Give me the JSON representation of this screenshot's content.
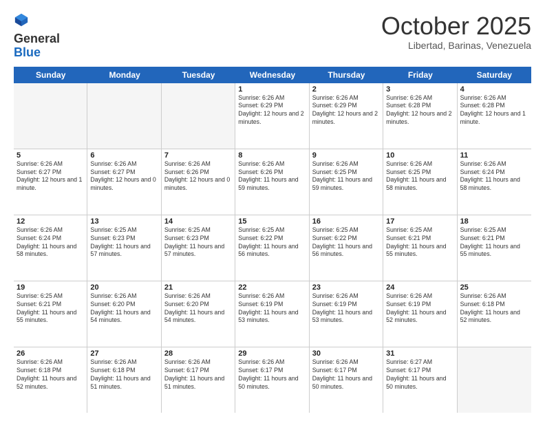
{
  "header": {
    "logo_general": "General",
    "logo_blue": "Blue",
    "month": "October 2025",
    "location": "Libertad, Barinas, Venezuela"
  },
  "days_of_week": [
    "Sunday",
    "Monday",
    "Tuesday",
    "Wednesday",
    "Thursday",
    "Friday",
    "Saturday"
  ],
  "weeks": [
    [
      {
        "day": "",
        "sunrise": "",
        "sunset": "",
        "daylight": "",
        "empty": true
      },
      {
        "day": "",
        "sunrise": "",
        "sunset": "",
        "daylight": "",
        "empty": true
      },
      {
        "day": "",
        "sunrise": "",
        "sunset": "",
        "daylight": "",
        "empty": true
      },
      {
        "day": "1",
        "sunrise": "Sunrise: 6:26 AM",
        "sunset": "Sunset: 6:29 PM",
        "daylight": "Daylight: 12 hours and 2 minutes.",
        "empty": false
      },
      {
        "day": "2",
        "sunrise": "Sunrise: 6:26 AM",
        "sunset": "Sunset: 6:29 PM",
        "daylight": "Daylight: 12 hours and 2 minutes.",
        "empty": false
      },
      {
        "day": "3",
        "sunrise": "Sunrise: 6:26 AM",
        "sunset": "Sunset: 6:28 PM",
        "daylight": "Daylight: 12 hours and 2 minutes.",
        "empty": false
      },
      {
        "day": "4",
        "sunrise": "Sunrise: 6:26 AM",
        "sunset": "Sunset: 6:28 PM",
        "daylight": "Daylight: 12 hours and 1 minute.",
        "empty": false
      }
    ],
    [
      {
        "day": "5",
        "sunrise": "Sunrise: 6:26 AM",
        "sunset": "Sunset: 6:27 PM",
        "daylight": "Daylight: 12 hours and 1 minute.",
        "empty": false
      },
      {
        "day": "6",
        "sunrise": "Sunrise: 6:26 AM",
        "sunset": "Sunset: 6:27 PM",
        "daylight": "Daylight: 12 hours and 0 minutes.",
        "empty": false
      },
      {
        "day": "7",
        "sunrise": "Sunrise: 6:26 AM",
        "sunset": "Sunset: 6:26 PM",
        "daylight": "Daylight: 12 hours and 0 minutes.",
        "empty": false
      },
      {
        "day": "8",
        "sunrise": "Sunrise: 6:26 AM",
        "sunset": "Sunset: 6:26 PM",
        "daylight": "Daylight: 11 hours and 59 minutes.",
        "empty": false
      },
      {
        "day": "9",
        "sunrise": "Sunrise: 6:26 AM",
        "sunset": "Sunset: 6:25 PM",
        "daylight": "Daylight: 11 hours and 59 minutes.",
        "empty": false
      },
      {
        "day": "10",
        "sunrise": "Sunrise: 6:26 AM",
        "sunset": "Sunset: 6:25 PM",
        "daylight": "Daylight: 11 hours and 58 minutes.",
        "empty": false
      },
      {
        "day": "11",
        "sunrise": "Sunrise: 6:26 AM",
        "sunset": "Sunset: 6:24 PM",
        "daylight": "Daylight: 11 hours and 58 minutes.",
        "empty": false
      }
    ],
    [
      {
        "day": "12",
        "sunrise": "Sunrise: 6:26 AM",
        "sunset": "Sunset: 6:24 PM",
        "daylight": "Daylight: 11 hours and 58 minutes.",
        "empty": false
      },
      {
        "day": "13",
        "sunrise": "Sunrise: 6:25 AM",
        "sunset": "Sunset: 6:23 PM",
        "daylight": "Daylight: 11 hours and 57 minutes.",
        "empty": false
      },
      {
        "day": "14",
        "sunrise": "Sunrise: 6:25 AM",
        "sunset": "Sunset: 6:23 PM",
        "daylight": "Daylight: 11 hours and 57 minutes.",
        "empty": false
      },
      {
        "day": "15",
        "sunrise": "Sunrise: 6:25 AM",
        "sunset": "Sunset: 6:22 PM",
        "daylight": "Daylight: 11 hours and 56 minutes.",
        "empty": false
      },
      {
        "day": "16",
        "sunrise": "Sunrise: 6:25 AM",
        "sunset": "Sunset: 6:22 PM",
        "daylight": "Daylight: 11 hours and 56 minutes.",
        "empty": false
      },
      {
        "day": "17",
        "sunrise": "Sunrise: 6:25 AM",
        "sunset": "Sunset: 6:21 PM",
        "daylight": "Daylight: 11 hours and 55 minutes.",
        "empty": false
      },
      {
        "day": "18",
        "sunrise": "Sunrise: 6:25 AM",
        "sunset": "Sunset: 6:21 PM",
        "daylight": "Daylight: 11 hours and 55 minutes.",
        "empty": false
      }
    ],
    [
      {
        "day": "19",
        "sunrise": "Sunrise: 6:25 AM",
        "sunset": "Sunset: 6:21 PM",
        "daylight": "Daylight: 11 hours and 55 minutes.",
        "empty": false
      },
      {
        "day": "20",
        "sunrise": "Sunrise: 6:26 AM",
        "sunset": "Sunset: 6:20 PM",
        "daylight": "Daylight: 11 hours and 54 minutes.",
        "empty": false
      },
      {
        "day": "21",
        "sunrise": "Sunrise: 6:26 AM",
        "sunset": "Sunset: 6:20 PM",
        "daylight": "Daylight: 11 hours and 54 minutes.",
        "empty": false
      },
      {
        "day": "22",
        "sunrise": "Sunrise: 6:26 AM",
        "sunset": "Sunset: 6:19 PM",
        "daylight": "Daylight: 11 hours and 53 minutes.",
        "empty": false
      },
      {
        "day": "23",
        "sunrise": "Sunrise: 6:26 AM",
        "sunset": "Sunset: 6:19 PM",
        "daylight": "Daylight: 11 hours and 53 minutes.",
        "empty": false
      },
      {
        "day": "24",
        "sunrise": "Sunrise: 6:26 AM",
        "sunset": "Sunset: 6:19 PM",
        "daylight": "Daylight: 11 hours and 52 minutes.",
        "empty": false
      },
      {
        "day": "25",
        "sunrise": "Sunrise: 6:26 AM",
        "sunset": "Sunset: 6:18 PM",
        "daylight": "Daylight: 11 hours and 52 minutes.",
        "empty": false
      }
    ],
    [
      {
        "day": "26",
        "sunrise": "Sunrise: 6:26 AM",
        "sunset": "Sunset: 6:18 PM",
        "daylight": "Daylight: 11 hours and 52 minutes.",
        "empty": false
      },
      {
        "day": "27",
        "sunrise": "Sunrise: 6:26 AM",
        "sunset": "Sunset: 6:18 PM",
        "daylight": "Daylight: 11 hours and 51 minutes.",
        "empty": false
      },
      {
        "day": "28",
        "sunrise": "Sunrise: 6:26 AM",
        "sunset": "Sunset: 6:17 PM",
        "daylight": "Daylight: 11 hours and 51 minutes.",
        "empty": false
      },
      {
        "day": "29",
        "sunrise": "Sunrise: 6:26 AM",
        "sunset": "Sunset: 6:17 PM",
        "daylight": "Daylight: 11 hours and 50 minutes.",
        "empty": false
      },
      {
        "day": "30",
        "sunrise": "Sunrise: 6:26 AM",
        "sunset": "Sunset: 6:17 PM",
        "daylight": "Daylight: 11 hours and 50 minutes.",
        "empty": false
      },
      {
        "day": "31",
        "sunrise": "Sunrise: 6:27 AM",
        "sunset": "Sunset: 6:17 PM",
        "daylight": "Daylight: 11 hours and 50 minutes.",
        "empty": false
      },
      {
        "day": "",
        "sunrise": "",
        "sunset": "",
        "daylight": "",
        "empty": true
      }
    ]
  ]
}
